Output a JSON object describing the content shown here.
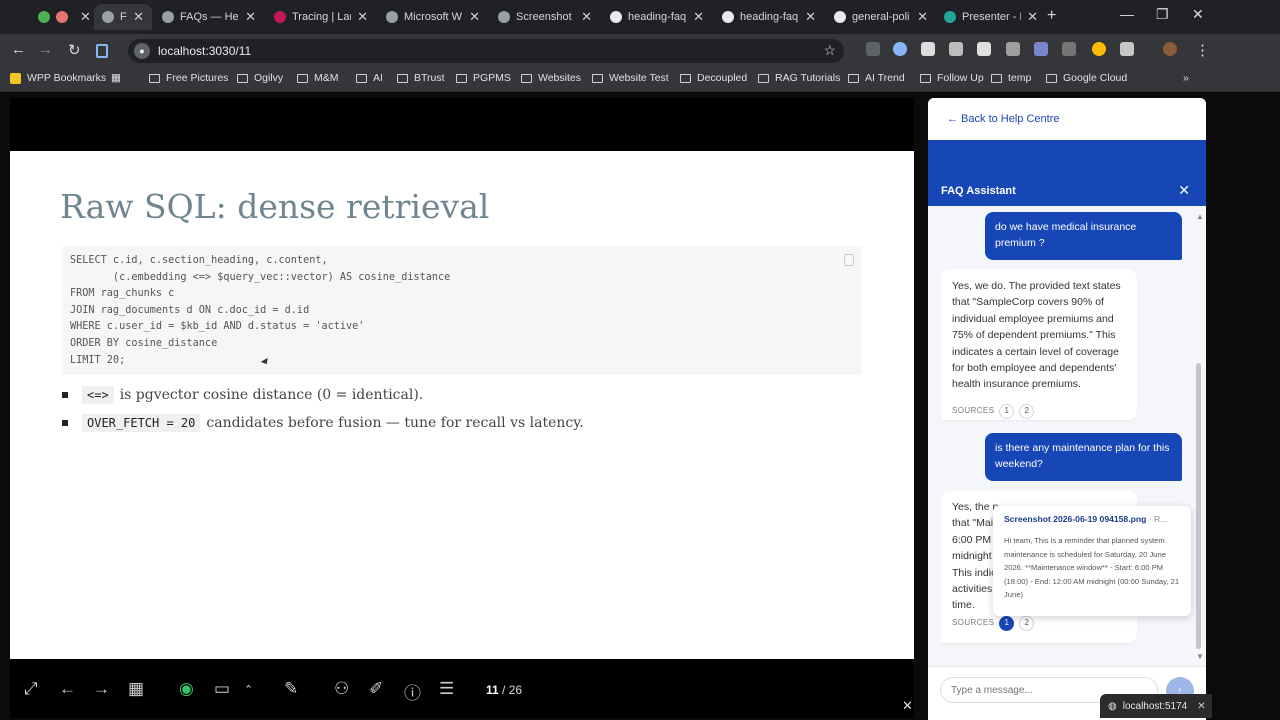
{
  "browser": {
    "tabs": [
      {
        "label": "",
        "active": false,
        "color": "#4caf50"
      },
      {
        "label": "F/",
        "active": true,
        "color": "#9aa0a6"
      },
      {
        "label": "FAQs — Help",
        "active": false,
        "color": "#9aa0a6"
      },
      {
        "label": "Tracing | Lang",
        "active": false,
        "color": "#c2185b"
      },
      {
        "label": "Microsoft W",
        "active": false,
        "color": "#9aa0a6"
      },
      {
        "label": "Screenshot 2",
        "active": false,
        "color": "#9aa0a6"
      },
      {
        "label": "heading-faq",
        "active": false,
        "color": "#e8eaed"
      },
      {
        "label": "heading-faq",
        "active": false,
        "color": "#e8eaed"
      },
      {
        "label": "general-poli",
        "active": false,
        "color": "#e8eaed"
      },
      {
        "label": "Presenter - R",
        "active": false,
        "color": "#26a69a"
      }
    ],
    "url": "localhost:3030/11",
    "bookmarks": [
      "WPP Bookmarks",
      "Free Pictures",
      "Ogilvy",
      "M&M",
      "AI",
      "BTrust",
      "PGPMS",
      "Websites",
      "Website Test",
      "Decoupled",
      "RAG Tutorials",
      "AI Trend",
      "Follow Up",
      "temp",
      "Google Cloud"
    ]
  },
  "slide": {
    "title": "Raw SQL: dense retrieval",
    "code_lines": [
      "SELECT c.id, c.section_heading, c.content,",
      "       (c.embedding <=> $query_vec::vector) AS cosine_distance",
      "FROM rag_chunks c",
      "JOIN rag_documents d ON c.doc_id = d.id",
      "WHERE c.user_id = $kb_id AND d.status = 'active'",
      "ORDER BY cosine_distance",
      "LIMIT 20;"
    ],
    "bullets": [
      {
        "code": "<=>",
        "text": "is pgvector cosine distance (0 = identical)."
      },
      {
        "code": "OVER_FETCH = 20",
        "text": "candidates before fusion — tune for recall vs latency."
      }
    ]
  },
  "controls": {
    "page_current": "11",
    "page_total": "/ 26"
  },
  "panel": {
    "back_link": "← Back to Help Centre",
    "assistant_title": "FAQ Assistant",
    "messages": [
      {
        "role": "user",
        "text": "do we have  medical insurance premium ?"
      },
      {
        "role": "bot",
        "text": "Yes, we do. The provided text states that \"SampleCorp covers 90% of individual employee premiums and 75% of dependent premiums.\" This indicates a certain level of coverage for both employee and dependents' health insurance premiums.",
        "sources_label": "SOURCES",
        "sources": [
          "1",
          "2"
        ]
      },
      {
        "role": "user",
        "text": "is there any maintenance plan for this weekend?"
      },
      {
        "role": "bot",
        "text": "Yes, the p                 that \"Mai 6:00 PM ( midnight This indic activities time.",
        "sources_label": "SOURCES",
        "sources": [
          "1",
          "2"
        ]
      }
    ],
    "tooltip": {
      "title": "Screenshot 2026-06-19 094158.png",
      "suffix": "· R...",
      "body": "Hi team, This is a reminder that planned system maintenance is scheduled for Saturday, 20 June 2026. **Maintenance window** - Start: 6:00 PM (18:00) - End: 12:00 AM midnight (00:00 Sunday, 21 June)"
    },
    "input_placeholder": "Type a message...",
    "status_host": "localhost:5174"
  },
  "colors": {
    "accent": "#1746b7",
    "slide_title": "#6f8590"
  }
}
